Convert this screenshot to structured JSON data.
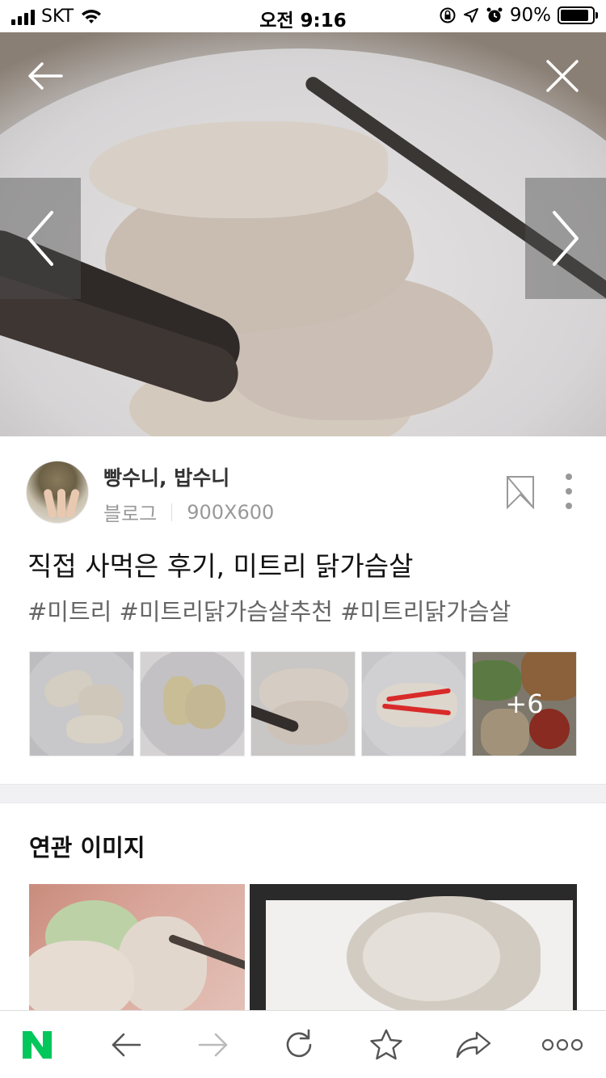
{
  "status_bar": {
    "carrier": "SKT",
    "time": "오전 9:16",
    "battery_percent": "90%",
    "battery_level": 0.9
  },
  "hero": {
    "back_icon": "arrow-left-icon",
    "close_icon": "close-icon",
    "prev_icon": "chevron-left-icon",
    "next_icon": "chevron-right-icon"
  },
  "post": {
    "author": "빵수니, 밥수니",
    "source": "블로그",
    "dimensions": "900X600",
    "title": "직접 사먹은 후기, 미트리 닭가슴살",
    "tags": "#미트리 #미트리닭가슴살추천 #미트리닭가슴살",
    "more_count": "+6"
  },
  "related": {
    "title": "연관 이미지"
  },
  "toolbar": {
    "items": [
      "naver-home-icon",
      "back-arrow-icon",
      "forward-arrow-icon",
      "reload-icon",
      "star-icon",
      "share-icon",
      "more-icon"
    ]
  },
  "colors": {
    "naver_green": "#03c75a",
    "text_primary": "#111111",
    "text_secondary": "#999999"
  }
}
